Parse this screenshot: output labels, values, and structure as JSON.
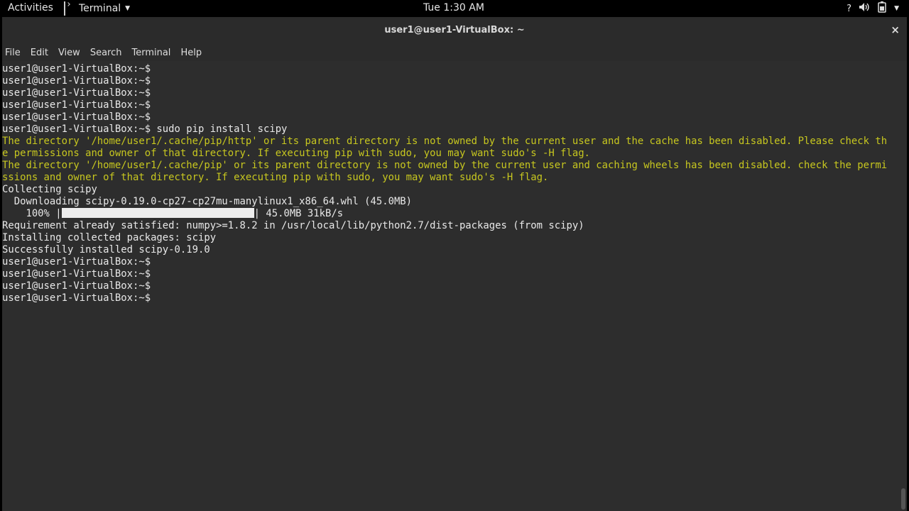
{
  "topbar": {
    "activities": "Activities",
    "app_name": "Terminal",
    "clock": "Tue  1:30 AM"
  },
  "window": {
    "title": "user1@user1-VirtualBox: ~",
    "close": "×"
  },
  "menu": [
    "File",
    "Edit",
    "View",
    "Search",
    "Terminal",
    "Help"
  ],
  "terminal": {
    "lines": [
      {
        "text": "user1@user1-VirtualBox:~$",
        "warn": false
      },
      {
        "text": "user1@user1-VirtualBox:~$",
        "warn": false
      },
      {
        "text": "user1@user1-VirtualBox:~$",
        "warn": false
      },
      {
        "text": "user1@user1-VirtualBox:~$",
        "warn": false
      },
      {
        "text": "user1@user1-VirtualBox:~$",
        "warn": false
      },
      {
        "text": "user1@user1-VirtualBox:~$ sudo pip install scipy",
        "warn": false
      },
      {
        "text": "The directory '/home/user1/.cache/pip/http' or its parent directory is not owned by the current user and the cache has been disabled. Please check th",
        "warn": true
      },
      {
        "text": "e permissions and owner of that directory. If executing pip with sudo, you may want sudo's -H flag.",
        "warn": true
      },
      {
        "text": "The directory '/home/user1/.cache/pip' or its parent directory is not owned by the current user and caching wheels has been disabled. check the permi",
        "warn": true
      },
      {
        "text": "ssions and owner of that directory. If executing pip with sudo, you may want sudo's -H flag.",
        "warn": true
      },
      {
        "text": "Collecting scipy",
        "warn": false
      },
      {
        "text": "  Downloading scipy-0.19.0-cp27-cp27mu-manylinux1_x86_64.whl (45.0MB)",
        "warn": false
      },
      {
        "progress": true,
        "prefix": "    100% |",
        "suffix": "| 45.0MB 31kB/s",
        "percent": 100
      },
      {
        "text": "Requirement already satisfied: numpy>=1.8.2 in /usr/local/lib/python2.7/dist-packages (from scipy)",
        "warn": false
      },
      {
        "text": "Installing collected packages: scipy",
        "warn": false
      },
      {
        "text": "Successfully installed scipy-0.19.0",
        "warn": false
      },
      {
        "text": "user1@user1-VirtualBox:~$",
        "warn": false
      },
      {
        "text": "user1@user1-VirtualBox:~$",
        "warn": false
      },
      {
        "text": "user1@user1-VirtualBox:~$",
        "warn": false
      },
      {
        "text": "user1@user1-VirtualBox:~$ ",
        "warn": false,
        "cursor": true
      }
    ]
  },
  "colors": {
    "terminal_bg": "#2d2d2d",
    "terminal_fg": "#e8e8e8",
    "warning_fg": "#c7c71f"
  },
  "icons": {
    "help": "question-icon",
    "volume": "volume-icon",
    "battery": "battery-icon",
    "system_menu": "chevron-down-icon"
  }
}
